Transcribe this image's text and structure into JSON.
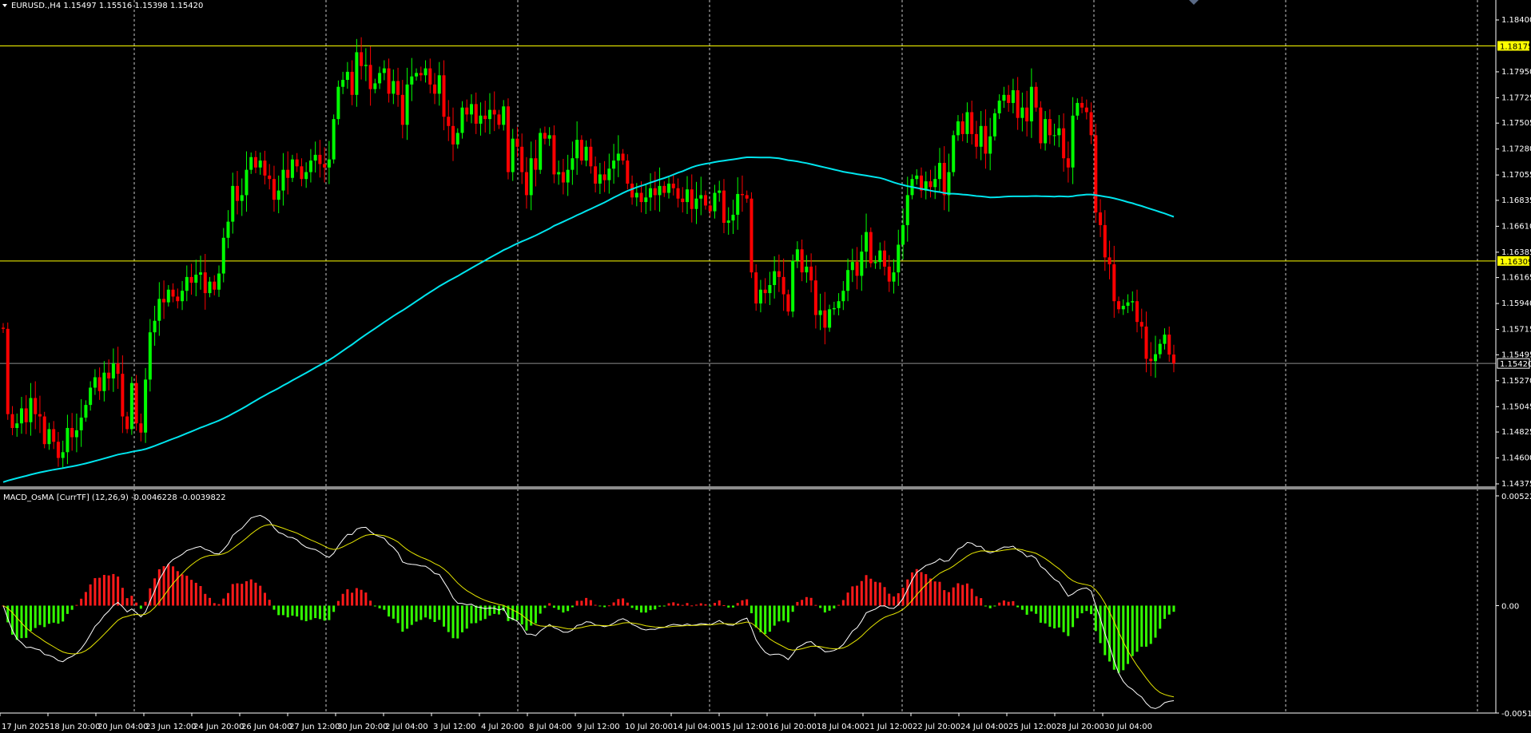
{
  "header": {
    "main_title": "EURUSD.,H4  1.15497 1.15516 1.15398 1.15420",
    "indicator_title": "MACD_OsMA [CurrTF] (12,26,9) -0.0046228 -0.0039822"
  },
  "colors": {
    "background": "#000000",
    "bull": "#00ff00",
    "bear": "#ff0000",
    "ma": "#00e5ee",
    "hline": "#ffff00",
    "price_line": "#8c8c8c",
    "macd": "#ffffff",
    "signal": "#e6e600",
    "hist_pos": "#ff1a1a",
    "hist_neg": "#33ff00"
  },
  "chart_data": [
    {
      "type": "candlestick",
      "symbol": "EURUSD.",
      "timeframe": "H4",
      "ohlc_last": {
        "open": 1.15497,
        "high": 1.15516,
        "low": 1.15398,
        "close": 1.1542
      },
      "ylim": [
        1.14375,
        1.1849
      ],
      "y_ticks": [
        "1.18400",
        "1.17950",
        "1.17725",
        "1.17505",
        "1.17280",
        "1.17055",
        "1.16835",
        "1.16610",
        "1.16385",
        "1.16165",
        "1.15940",
        "1.15715",
        "1.15495",
        "1.15270",
        "1.15045",
        "1.14825",
        "1.14600",
        "1.14375"
      ],
      "x_ticks": [
        "17 Jun 2025",
        "18 Jun 20:00",
        "20 Jun 04:00",
        "23 Jun 12:00",
        "24 Jun 20:00",
        "26 Jun 04:00",
        "27 Jun 12:00",
        "30 Jun 20:00",
        "2 Jul 04:00",
        "3 Jul 12:00",
        "4 Jul 20:00",
        "8 Jul 04:00",
        "9 Jul 12:00",
        "10 Jul 20:00",
        "14 Jul 04:00",
        "15 Jul 12:00",
        "16 Jul 20:00",
        "18 Jul 04:00",
        "21 Jul 12:00",
        "22 Jul 20:00",
        "24 Jul 04:00",
        "25 Jul 12:00",
        "28 Jul 20:00",
        "30 Jul 04:00"
      ],
      "horizontal_lines": [
        {
          "label": "1.18175",
          "value": 1.18175
        },
        {
          "label": "1.16309",
          "value": 1.16309
        }
      ],
      "current_price": {
        "label": "1.15420",
        "value": 1.1542
      },
      "closes": [
        1.1572,
        1.1498,
        1.1486,
        1.149,
        1.1503,
        1.1491,
        1.1512,
        1.1498,
        1.1496,
        1.1472,
        1.1485,
        1.1474,
        1.146,
        1.1465,
        1.1486,
        1.1478,
        1.1484,
        1.1495,
        1.1506,
        1.1521,
        1.153,
        1.1518,
        1.1534,
        1.1529,
        1.1542,
        1.1533,
        1.1496,
        1.1485,
        1.1525,
        1.149,
        1.1482,
        1.1528,
        1.1569,
        1.1579,
        1.1598,
        1.1595,
        1.1606,
        1.16,
        1.1596,
        1.1605,
        1.1617,
        1.1612,
        1.1619,
        1.1621,
        1.1603,
        1.1613,
        1.1606,
        1.162,
        1.1651,
        1.1665,
        1.1696,
        1.1683,
        1.1688,
        1.171,
        1.1721,
        1.1712,
        1.1718,
        1.1705,
        1.1702,
        1.1684,
        1.1692,
        1.171,
        1.1703,
        1.1719,
        1.1713,
        1.1702,
        1.1708,
        1.1718,
        1.1723,
        1.1715,
        1.1712,
        1.1719,
        1.1754,
        1.1782,
        1.1788,
        1.1795,
        1.1775,
        1.1812,
        1.18,
        1.1801,
        1.178,
        1.1785,
        1.1794,
        1.1798,
        1.1776,
        1.1787,
        1.1775,
        1.1749,
        1.1784,
        1.1791,
        1.1794,
        1.1792,
        1.1798,
        1.1784,
        1.1776,
        1.1792,
        1.1756,
        1.1748,
        1.1732,
        1.1742,
        1.1764,
        1.1758,
        1.1767,
        1.175,
        1.1757,
        1.1754,
        1.1762,
        1.1758,
        1.1749,
        1.1765,
        1.1708,
        1.1737,
        1.173,
        1.1708,
        1.1688,
        1.172,
        1.171,
        1.1742,
        1.1737,
        1.174,
        1.1706,
        1.1708,
        1.1699,
        1.171,
        1.172,
        1.1736,
        1.1718,
        1.173,
        1.1713,
        1.1698,
        1.1706,
        1.1701,
        1.1711,
        1.1718,
        1.1724,
        1.1718,
        1.1698,
        1.1686,
        1.169,
        1.1682,
        1.1686,
        1.1694,
        1.1688,
        1.1696,
        1.169,
        1.1698,
        1.1694,
        1.1685,
        1.1682,
        1.1693,
        1.1676,
        1.1685,
        1.1688,
        1.1679,
        1.1674,
        1.169,
        1.1692,
        1.1664,
        1.1666,
        1.1671,
        1.1689,
        1.1688,
        1.1685,
        1.1621,
        1.1594,
        1.1606,
        1.1603,
        1.161,
        1.1622,
        1.1617,
        1.1602,
        1.1587,
        1.1631,
        1.1641,
        1.1621,
        1.1626,
        1.1614,
        1.1584,
        1.1588,
        1.1573,
        1.1589,
        1.159,
        1.1596,
        1.1605,
        1.1623,
        1.163,
        1.1618,
        1.1639,
        1.1656,
        1.1629,
        1.163,
        1.164,
        1.1626,
        1.1613,
        1.1621,
        1.1645,
        1.1662,
        1.1688,
        1.1702,
        1.1705,
        1.1692,
        1.17,
        1.1695,
        1.1702,
        1.1716,
        1.1688,
        1.1708,
        1.174,
        1.1752,
        1.1741,
        1.176,
        1.1741,
        1.173,
        1.1748,
        1.1724,
        1.1739,
        1.1759,
        1.177,
        1.1775,
        1.1768,
        1.1779,
        1.1755,
        1.1764,
        1.1752,
        1.1782,
        1.1764,
        1.1733,
        1.1754,
        1.174,
        1.174,
        1.1746,
        1.172,
        1.1712,
        1.1757,
        1.1768,
        1.1764,
        1.176,
        1.174,
        1.1673,
        1.1662,
        1.1634,
        1.1628,
        1.1596,
        1.1589,
        1.1592,
        1.1595,
        1.1596,
        1.1578,
        1.1574,
        1.1546,
        1.1544,
        1.155,
        1.1559,
        1.1567,
        1.15497,
        1.1542
      ],
      "ma_label": "MA"
    },
    {
      "type": "bar+line",
      "name": "MACD_OsMA",
      "ylim": [
        -0.005113,
        0.005224
      ],
      "y_ticks": [
        "0.005224",
        "0.00",
        "-0.005113"
      ],
      "last_values": [
        -0.0046228,
        -0.0039822
      ]
    }
  ]
}
